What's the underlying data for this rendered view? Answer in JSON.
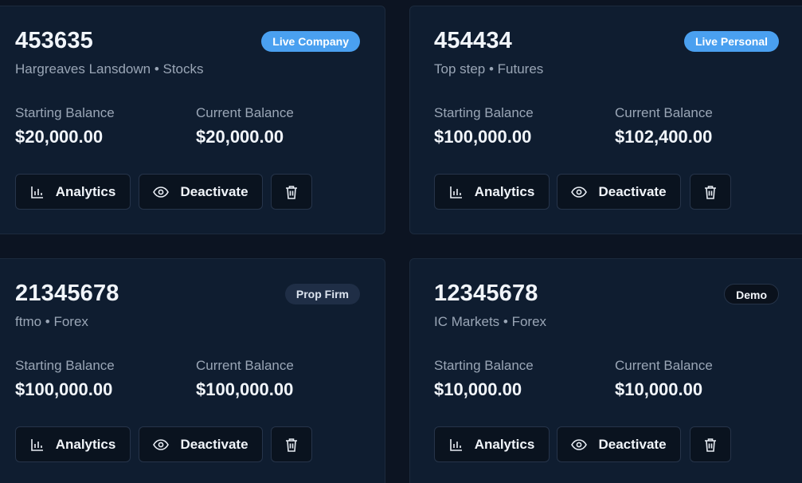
{
  "labels": {
    "starting_balance": "Starting Balance",
    "current_balance": "Current Balance",
    "analytics": "Analytics",
    "deactivate": "Deactivate"
  },
  "icons": {
    "analytics": "bar-chart-icon",
    "deactivate": "eye-icon",
    "delete": "trash-icon"
  },
  "colors": {
    "background": "#0c1422",
    "card": "#0f1d30",
    "badge_blue": "#4aa0f0",
    "badge_navy": "#1f2e46",
    "badge_dark": "#0a111c"
  },
  "accounts": [
    {
      "number": "453635",
      "broker": "Hargreaves Lansdown",
      "market": "Stocks",
      "subtitle": "Hargreaves Lansdown • Stocks",
      "badge": "Live Company",
      "starting_balance": "$20,000.00",
      "current_balance": "$20,000.00"
    },
    {
      "number": "454434",
      "broker": "Top step",
      "market": "Futures",
      "subtitle": "Top step • Futures",
      "badge": "Live Personal",
      "starting_balance": "$100,000.00",
      "current_balance": "$102,400.00"
    },
    {
      "number": "21345678",
      "broker": "ftmo",
      "market": "Forex",
      "subtitle": "ftmo • Forex",
      "badge": "Prop Firm",
      "starting_balance": "$100,000.00",
      "current_balance": "$100,000.00"
    },
    {
      "number": "12345678",
      "broker": "IC Markets",
      "market": "Forex",
      "subtitle": "IC Markets • Forex",
      "badge": "Demo",
      "starting_balance": "$10,000.00",
      "current_balance": "$10,000.00"
    }
  ]
}
